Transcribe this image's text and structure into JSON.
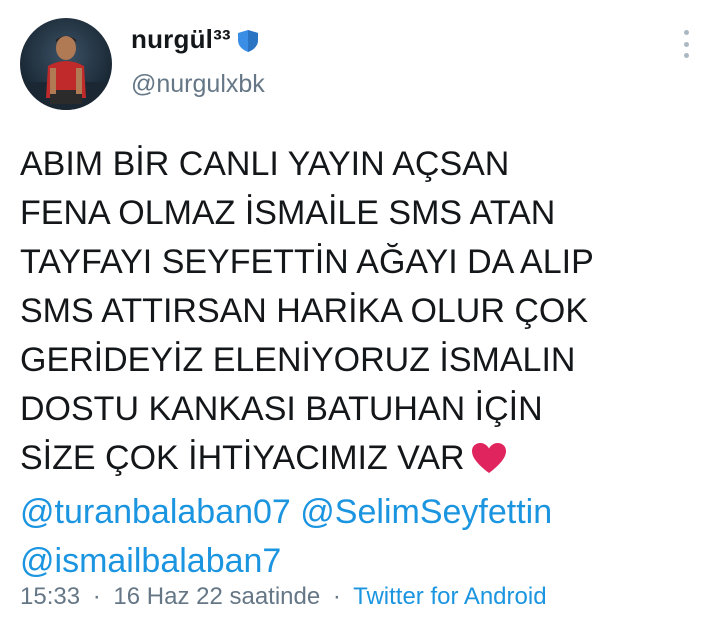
{
  "author": {
    "display_name": "nurgül³³",
    "badge_icon": "blue-shield-icon",
    "handle": "@nurgulxbk",
    "avatar_icon": "profile-photo"
  },
  "header": {
    "menu_icon": "vertical-ellipsis-icon"
  },
  "tweet": {
    "lines": [
      "ABIM BİR CANLI YAYIN AÇSAN",
      "FENA OLMAZ İSMAİLE SMS ATAN",
      "TAYFAYI SEYFETTİN AĞAYI DA ALIP",
      "SMS ATTIRSAN HARİKA OLUR ÇOK",
      "GERİDEYİZ ELENİYORUZ İSMALIN",
      "DOSTU KANKASI BATUHAN İÇİN",
      "SİZE ÇOK İHTİYACIMIZ VAR"
    ],
    "emoji": "red-heart-icon",
    "mentions": [
      "@turanbalaban07",
      "@SelimSeyfettin",
      "@ismailbalaban7"
    ]
  },
  "meta": {
    "time": "15:33",
    "separator": "·",
    "date_text": "16 Haz 22 saatinde",
    "source": "Twitter for Android"
  },
  "colors": {
    "link": "#1b95e0",
    "secondary_text": "#657786",
    "primary_text": "#14171a",
    "heart": "#e0245e",
    "badge": "#3a8ee6"
  }
}
